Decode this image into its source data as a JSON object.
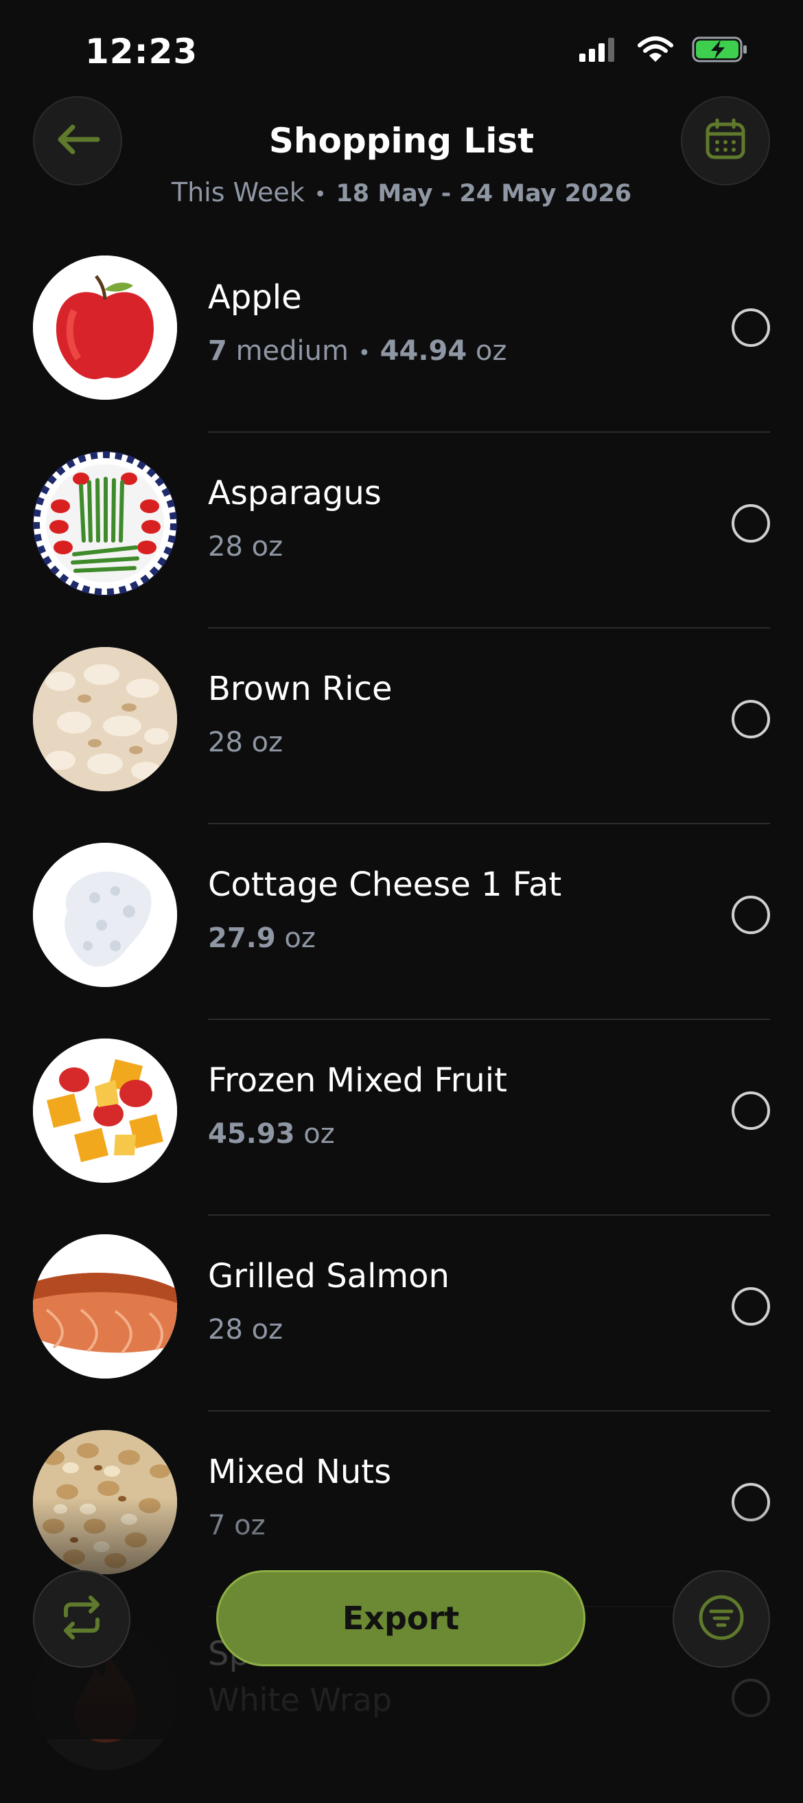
{
  "status_bar": {
    "time": "12:23"
  },
  "header": {
    "title": "Shopping List",
    "subtitle_period": "This Week",
    "subtitle_range": "18 May - 24 May 2026"
  },
  "items": [
    {
      "name": "Apple",
      "count": "7",
      "unit": "medium",
      "amount": "44.94",
      "amount_unit": "oz",
      "checked": false
    },
    {
      "name": "Asparagus",
      "amount": "28",
      "amount_unit": "oz",
      "checked": false
    },
    {
      "name": "Brown Rice",
      "amount": "28",
      "amount_unit": "oz",
      "checked": false
    },
    {
      "name": "Cottage Cheese 1 Fat",
      "amount": "27.9",
      "amount_unit": "oz",
      "checked": false
    },
    {
      "name": "Frozen Mixed Fruit",
      "amount": "45.93",
      "amount_unit": "oz",
      "checked": false
    },
    {
      "name": "Grilled Salmon",
      "amount": "28",
      "amount_unit": "oz",
      "checked": false
    },
    {
      "name": "Mixed Nuts",
      "amount": "7",
      "amount_unit": "oz",
      "checked": false
    }
  ],
  "partial_item": {
    "name_line1": "Sp",
    "name_line2": "White Wrap"
  },
  "actions": {
    "export_label": "Export"
  },
  "icons": {
    "back": "arrow-left-icon",
    "calendar": "calendar-icon",
    "repeat": "repeat-icon",
    "filter": "filter-icon"
  },
  "colors": {
    "accent": "#6b8a33",
    "accent_border": "#8db045",
    "icon_green": "#5f7a2c",
    "muted": "#8f97a4"
  }
}
